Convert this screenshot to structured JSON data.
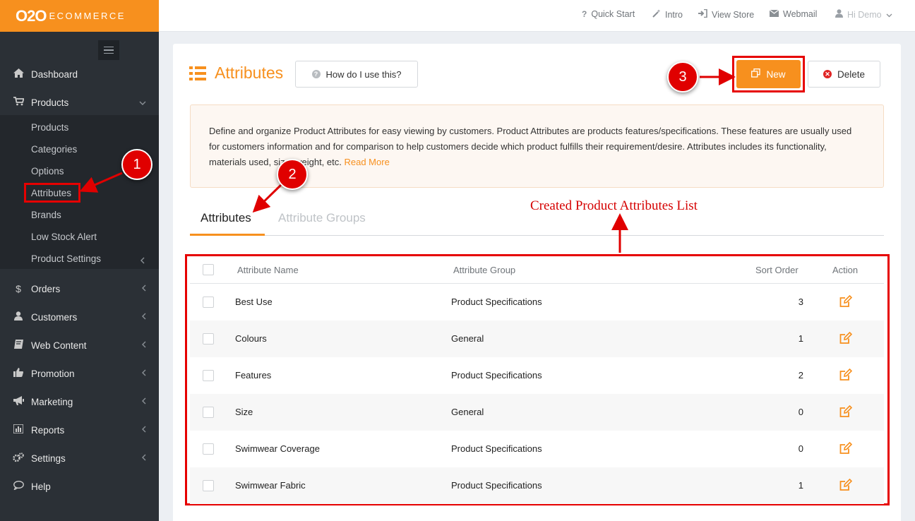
{
  "brand": {
    "logo_main": "O2O",
    "logo_sub": "ECOMMERCE"
  },
  "topbar": {
    "quick_start": "Quick Start",
    "intro": "Intro",
    "view_store": "View Store",
    "webmail": "Webmail",
    "user": "Hi Demo"
  },
  "sidebar": {
    "dashboard": "Dashboard",
    "products": "Products",
    "products_sub": [
      "Products",
      "Categories",
      "Options",
      "Attributes",
      "Brands",
      "Low Stock Alert",
      "Product Settings"
    ],
    "orders": "Orders",
    "customers": "Customers",
    "web_content": "Web Content",
    "promotion": "Promotion",
    "marketing": "Marketing",
    "reports": "Reports",
    "settings": "Settings",
    "help": "Help"
  },
  "page": {
    "title": "Attributes",
    "how_button": "How do I use this?",
    "new_button": "New",
    "delete_button": "Delete",
    "description": "Define and organize Product Attributes for easy viewing by customers. Product Attributes are products features/specifications. These features are usually used for customers information and for comparison to help customers decide which product fulfills their requirement/desire. Attributes includes its functionality, materials used, size, weight, etc.",
    "read_more": "Read More"
  },
  "tabs": {
    "active": "Attributes",
    "inactive": "Attribute Groups"
  },
  "annotation": {
    "label": "Created Product Attributes List",
    "badge1": "1",
    "badge2": "2",
    "badge3": "3"
  },
  "table": {
    "headers": {
      "name": "Attribute Name",
      "group": "Attribute Group",
      "sort": "Sort Order",
      "action": "Action"
    },
    "rows": [
      {
        "name": "Best Use",
        "group": "Product Specifications",
        "sort": "3"
      },
      {
        "name": "Colours",
        "group": "General",
        "sort": "1"
      },
      {
        "name": "Features",
        "group": "Product Specifications",
        "sort": "2"
      },
      {
        "name": "Size",
        "group": "General",
        "sort": "0"
      },
      {
        "name": "Swimwear Coverage",
        "group": "Product Specifications",
        "sort": "0"
      },
      {
        "name": "Swimwear Fabric",
        "group": "Product Specifications",
        "sort": "1"
      }
    ]
  },
  "colors": {
    "accent": "#f7901e",
    "sidebar": "#2b3036",
    "annotation_red": "#e60000"
  }
}
